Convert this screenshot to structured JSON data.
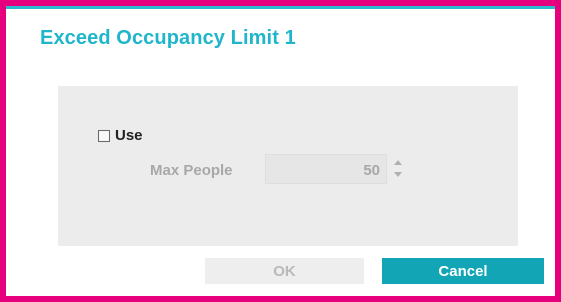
{
  "dialog": {
    "title": "Exceed Occupancy Limit 1"
  },
  "settings": {
    "use_label": "Use",
    "use_checked": false,
    "max_people_label": "Max People",
    "max_people_value": "50"
  },
  "buttons": {
    "ok_label": "OK",
    "cancel_label": "Cancel"
  },
  "colors": {
    "frame_border": "#e6007e",
    "title": "#1fb6cc",
    "accent": "#11a5b6"
  }
}
